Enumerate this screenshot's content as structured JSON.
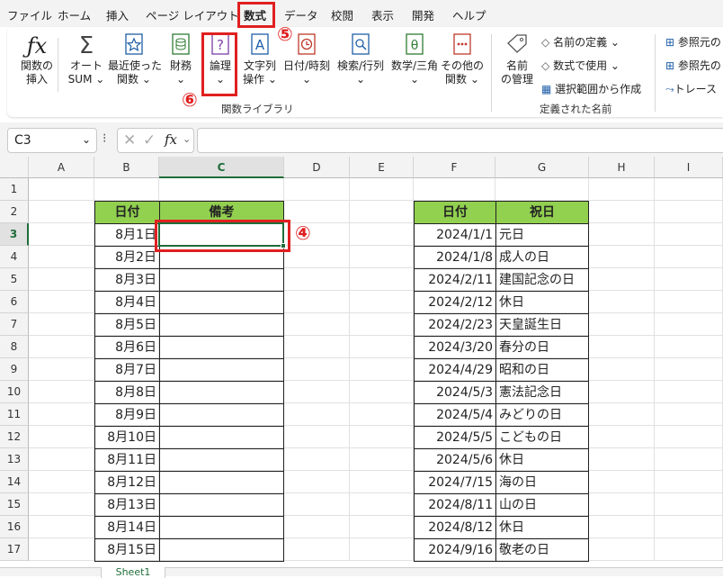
{
  "menu": [
    "ファイル",
    "ホーム",
    "挿入",
    "ページ レイアウト",
    "数式",
    "データ",
    "校閲",
    "表示",
    "開発",
    "ヘルプ"
  ],
  "ribbon": {
    "insert_function": [
      "関数の",
      "挿入"
    ],
    "autosum": [
      "オート",
      "SUM"
    ],
    "recent": [
      "最近使った",
      "関数"
    ],
    "financial": "財務",
    "logical": "論理",
    "text": [
      "文字列",
      "操作"
    ],
    "datetime": "日付/時刻",
    "lookup": "検索/行列",
    "math": "数学/三角",
    "other": [
      "その他の",
      "関数"
    ],
    "name_manager": [
      "名前",
      "の管理"
    ],
    "define_name": "名前の定義",
    "use_in_formula": "数式で使用",
    "create_from_selection": "選択範囲から作成",
    "trace_precedents": "参照元の",
    "trace_dependents": "参照先の",
    "trace": "トレース",
    "group_library": "関数ライブラリ",
    "group_names": "定義された名前"
  },
  "formula_bar": {
    "name_box": "C3",
    "fx": "fx"
  },
  "columns": [
    "A",
    "B",
    "C",
    "D",
    "E",
    "F",
    "G",
    "H",
    "I"
  ],
  "rows": [
    "1",
    "2",
    "3",
    "4",
    "5",
    "6",
    "7",
    "8",
    "9",
    "10",
    "11",
    "12",
    "13",
    "14",
    "15",
    "16",
    "17"
  ],
  "table1": {
    "headers": [
      "日付",
      "備考"
    ],
    "dates": [
      "8月1日",
      "8月2日",
      "8月3日",
      "8月4日",
      "8月5日",
      "8月6日",
      "8月7日",
      "8月8日",
      "8月9日",
      "8月10日",
      "8月11日",
      "8月12日",
      "8月13日",
      "8月14日",
      "8月15日"
    ]
  },
  "table2": {
    "headers": [
      "日付",
      "祝日"
    ],
    "dates": [
      "2024/1/1",
      "2024/1/8",
      "2024/2/11",
      "2024/2/12",
      "2024/2/23",
      "2024/3/20",
      "2024/4/29",
      "2024/5/3",
      "2024/5/4",
      "2024/5/5",
      "2024/5/6",
      "2024/7/15",
      "2024/8/11",
      "2024/8/12",
      "2024/9/16"
    ],
    "names": [
      "元日",
      "成人の日",
      "建国記念の日",
      "休日",
      "天皇誕生日",
      "春分の日",
      "昭和の日",
      "憲法記念日",
      "みどりの日",
      "こどもの日",
      "休日",
      "海の日",
      "山の日",
      "休日",
      "敬老の日"
    ]
  },
  "annotations": {
    "n4": "④",
    "n5": "⑤",
    "n6": "⑥"
  },
  "sheet_tab": "Sheet1",
  "colors": {
    "header_green": "#92d050",
    "highlight_red": "#e02020"
  }
}
